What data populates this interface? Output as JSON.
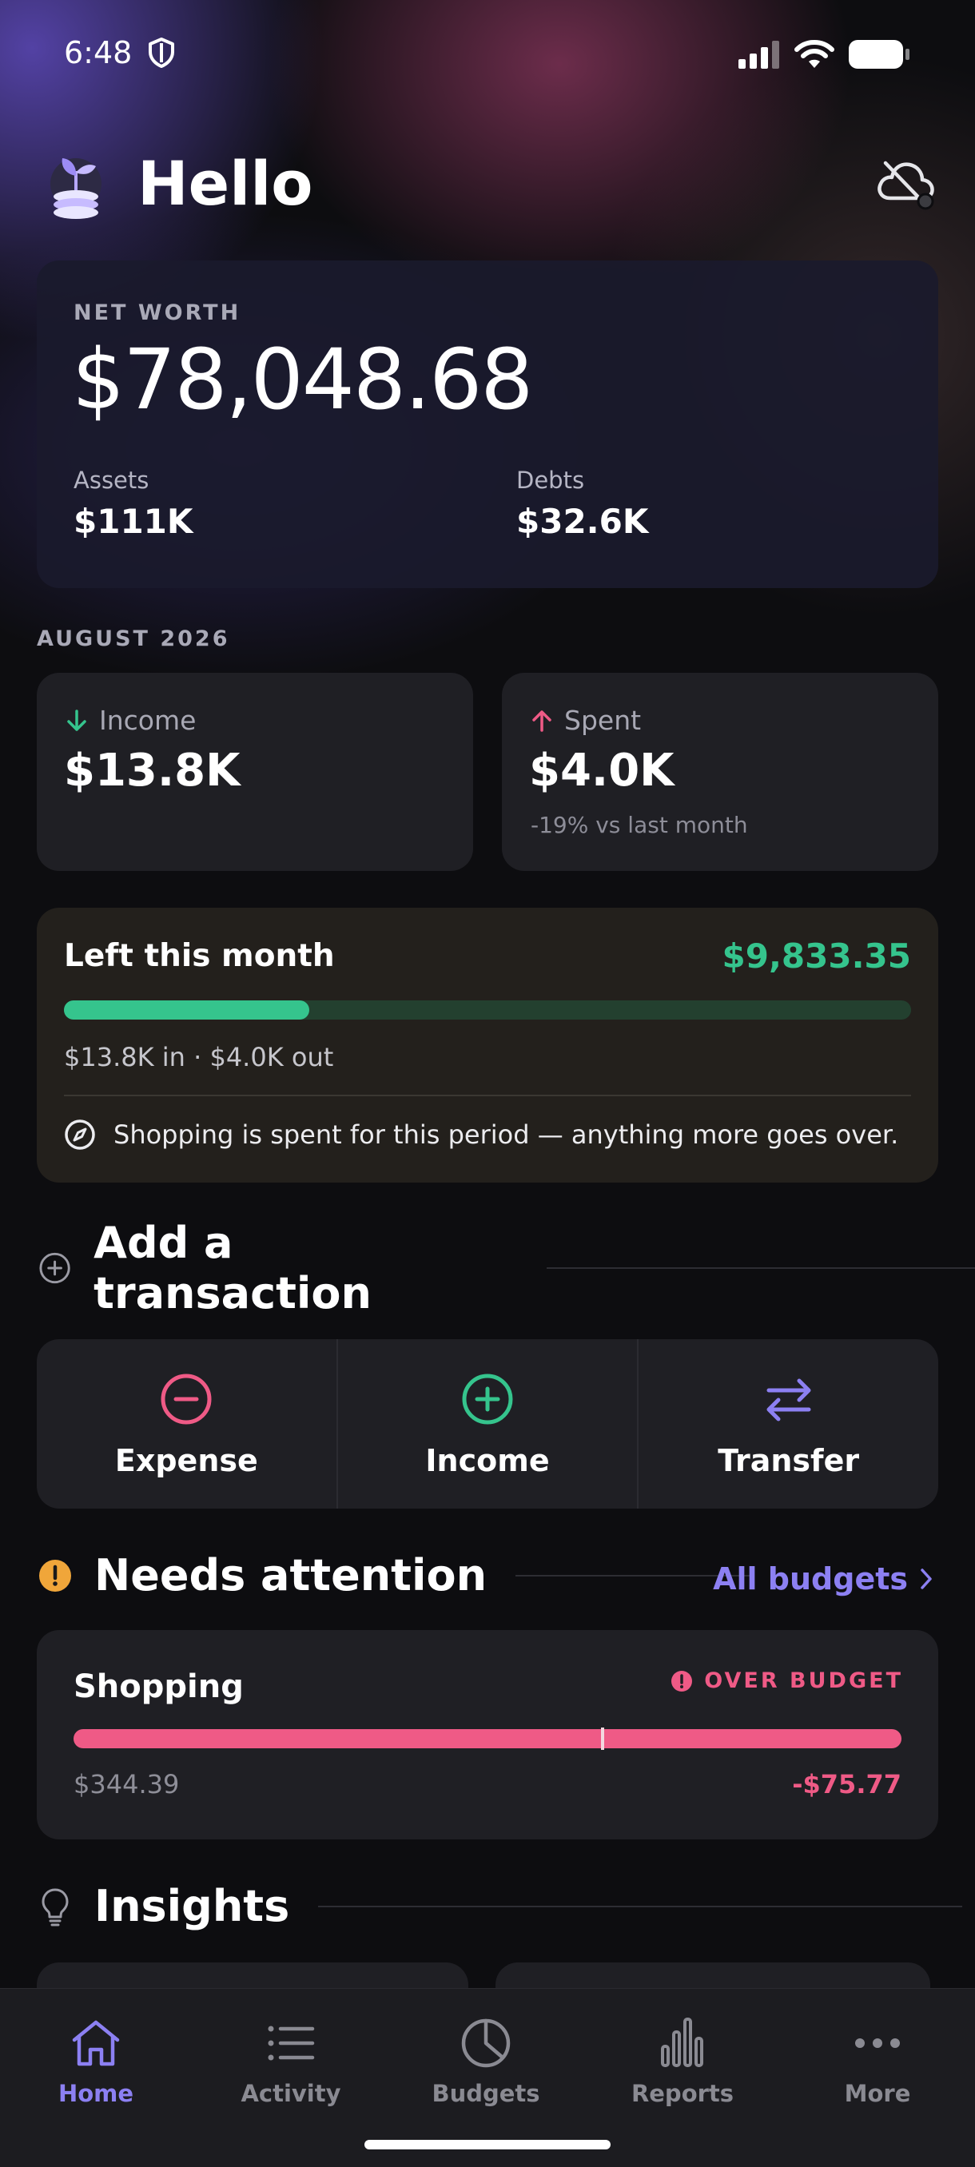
{
  "status_bar": {
    "time": "6:48"
  },
  "header": {
    "greeting": "Hello"
  },
  "net_worth": {
    "label": "NET WORTH",
    "value": "$78,048.68",
    "assets_label": "Assets",
    "assets_value": "$111K",
    "debts_label": "Debts",
    "debts_value": "$32.6K"
  },
  "period": {
    "label": "AUGUST 2026"
  },
  "income_card": {
    "label": "Income",
    "value": "$13.8K"
  },
  "spent_card": {
    "label": "Spent",
    "value": "$4.0K",
    "note": "-19% vs last month"
  },
  "left_this_month": {
    "title": "Left this month",
    "amount": "$9,833.35",
    "progress_fraction": 0.29,
    "summary": "$13.8K in · $4.0K out",
    "tip": "Shopping is spent for this period — anything more goes over."
  },
  "add_transaction": {
    "title": "Add a transaction",
    "actions": [
      {
        "label": "Expense",
        "icon": "minus-circle-icon",
        "color": "#ef5a86"
      },
      {
        "label": "Income",
        "icon": "plus-circle-icon",
        "color": "#35c48d"
      },
      {
        "label": "Transfer",
        "icon": "transfer-arrows-icon",
        "color": "#8c80f2"
      }
    ]
  },
  "needs_attention": {
    "title": "Needs attention",
    "link": "All budgets",
    "budget": {
      "name": "Shopping",
      "badge": "OVER BUDGET",
      "spent": "$344.39",
      "remaining": "-$75.77"
    }
  },
  "insights": {
    "title": "Insights"
  },
  "tabs": [
    {
      "label": "Home",
      "icon": "home-icon",
      "active": true
    },
    {
      "label": "Activity",
      "icon": "list-icon",
      "active": false
    },
    {
      "label": "Budgets",
      "icon": "pie-chart-icon",
      "active": false
    },
    {
      "label": "Reports",
      "icon": "bar-chart-icon",
      "active": false
    },
    {
      "label": "More",
      "icon": "more-dots-icon",
      "active": false
    }
  ],
  "colors": {
    "accent": "#8c80f2",
    "positive": "#35c48d",
    "negative": "#ef5a86",
    "warning": "#f0a63a"
  }
}
